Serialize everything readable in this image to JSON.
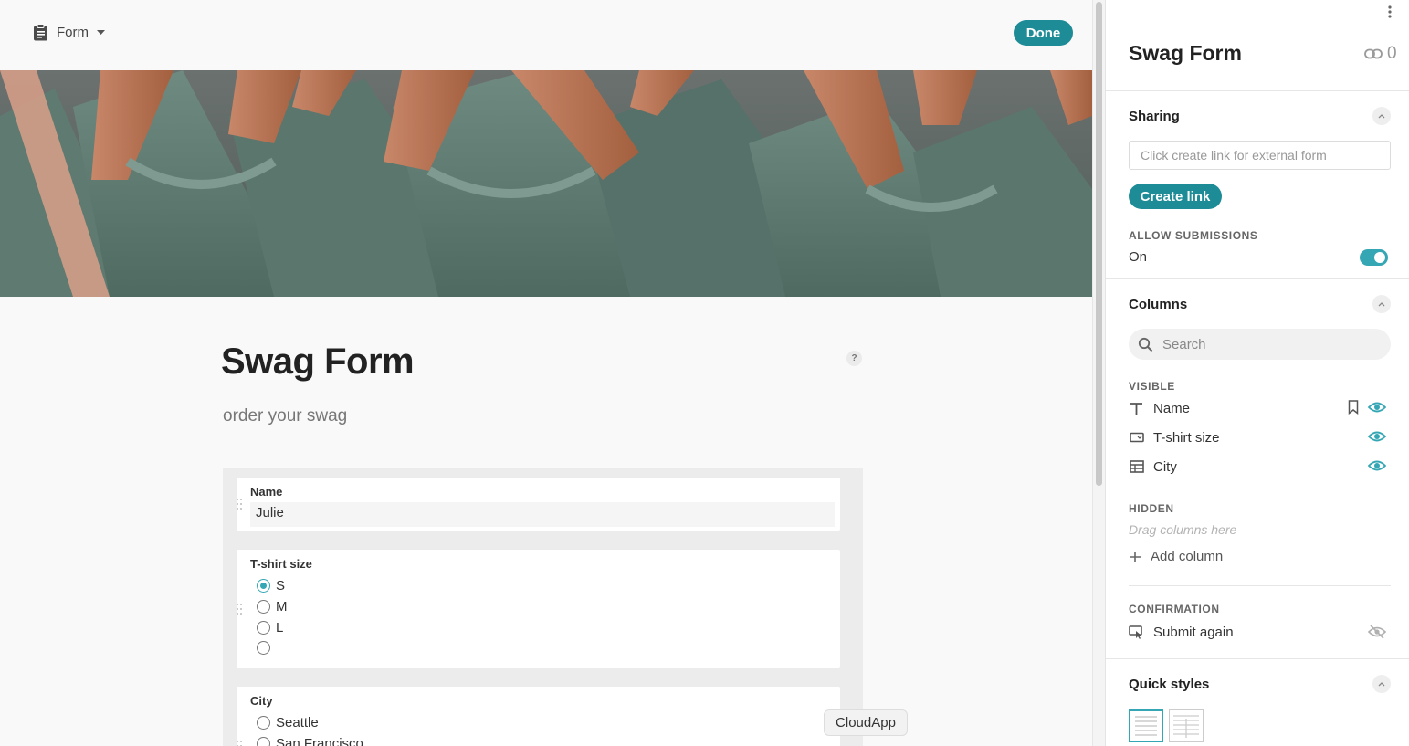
{
  "topbar": {
    "view_label": "Form",
    "done_label": "Done"
  },
  "form": {
    "title": "Swag Form",
    "description": "order your swag",
    "help_label": "?",
    "fields": {
      "name": {
        "label": "Name",
        "value": "Julie"
      },
      "tshirt": {
        "label": "T-shirt size",
        "options": [
          "S",
          "M",
          "L",
          ""
        ],
        "selected": "S"
      },
      "city": {
        "label": "City",
        "options": [
          "Seattle",
          "San Francisco"
        ]
      }
    }
  },
  "tooltip": "CloudApp",
  "panel": {
    "title": "Swag Form",
    "link_count": "0",
    "sharing": {
      "title": "Sharing",
      "placeholder": "Click create link for external form",
      "create_label": "Create link",
      "allow_label": "ALLOW SUBMISSIONS",
      "allow_state": "On"
    },
    "columns": {
      "title": "Columns",
      "search_placeholder": "Search",
      "visible_label": "VISIBLE",
      "visible": [
        {
          "label": "Name",
          "icon": "text-type-icon"
        },
        {
          "label": "T-shirt size",
          "icon": "select-type-icon"
        },
        {
          "label": "City",
          "icon": "table-type-icon"
        }
      ],
      "hidden_label": "HIDDEN",
      "hidden_hint": "Drag columns here",
      "add_label": "Add column",
      "confirmation_label": "CONFIRMATION",
      "submit_again": "Submit again"
    },
    "quick_styles": {
      "title": "Quick styles"
    }
  },
  "colors": {
    "accent": "#1e8c97",
    "accent_light": "#35a7b4"
  }
}
